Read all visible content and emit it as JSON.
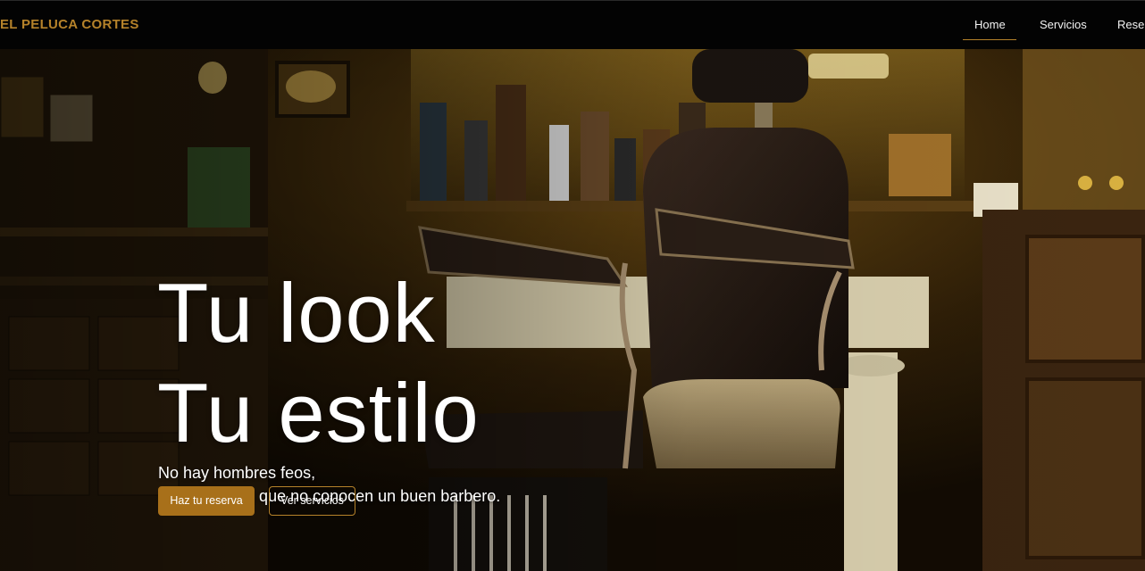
{
  "navbar": {
    "brand": "EL PELUCA CORTES",
    "links": [
      {
        "label": "Home",
        "active": true
      },
      {
        "label": "Servicios",
        "active": false
      },
      {
        "label": "Reservas",
        "active": false
      }
    ]
  },
  "hero": {
    "title_line1": "Tu look",
    "title_line2": "Tu estilo",
    "subtitle_line1": "No hay hombres feos,",
    "subtitle_line2": "solo hombres que no conocen un buen barbero.",
    "primary_button": "Haz tu reserva",
    "secondary_button": "Ver servicios"
  },
  "colors": {
    "accent": "#b5822a",
    "button_primary": "#a8701a",
    "navbar_bg": "#030303",
    "text": "#ffffff"
  }
}
